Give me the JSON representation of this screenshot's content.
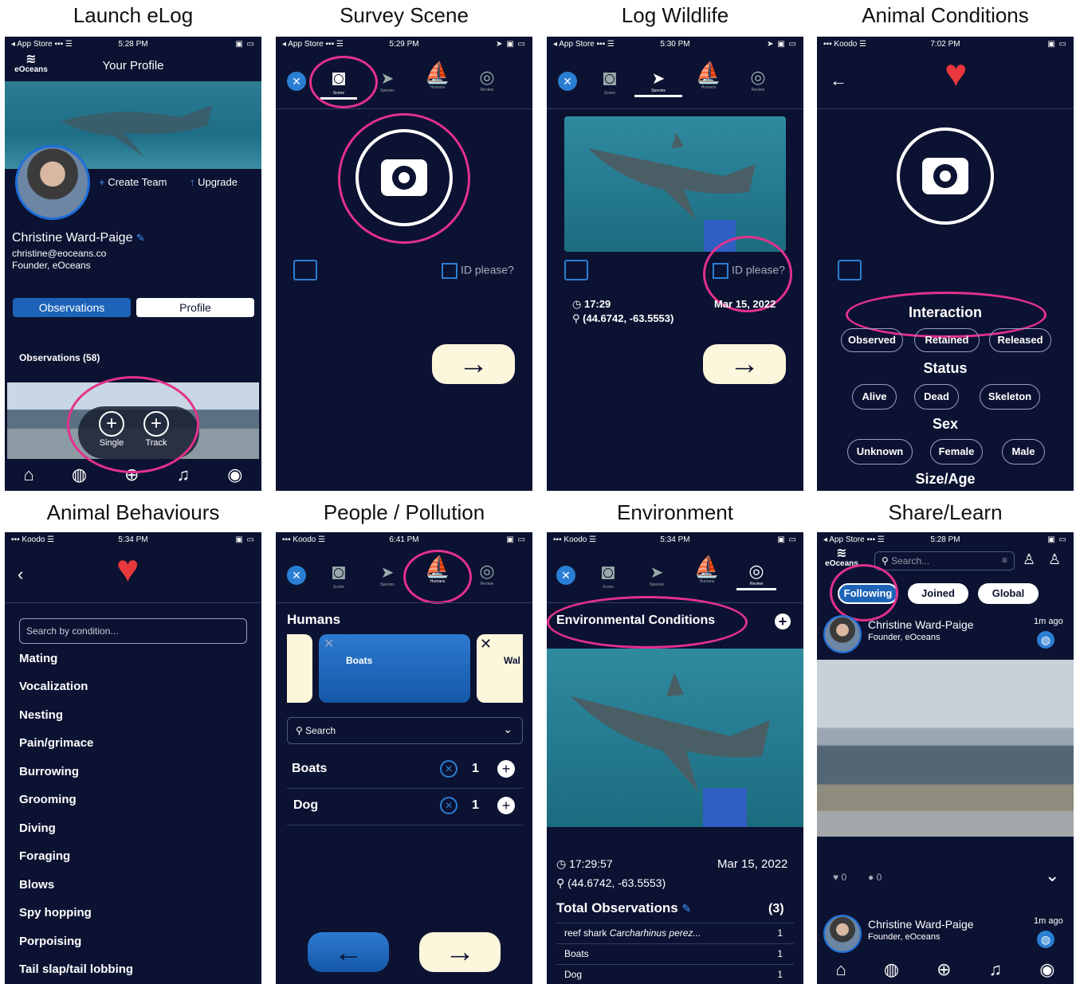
{
  "titles": [
    "Launch eLog",
    "Survey Scene",
    "Log Wildlife",
    "Animal Conditions",
    "Animal Behaviours",
    "People / Pollution",
    "Environment",
    "Share/Learn"
  ],
  "status": {
    "p1": {
      "left": "◂ App Store ▪▪▪ ☰",
      "time": "5:28 PM"
    },
    "p2": {
      "left": "◂ App Store ▪▪▪ ☰",
      "time": "5:29 PM"
    },
    "p3": {
      "left": "◂ App Store ▪▪▪ ☰",
      "time": "5:30 PM"
    },
    "p4": {
      "left": "▪▪▪ Koodo ☰",
      "time": "7:02 PM"
    },
    "p5": {
      "left": "▪▪▪ Koodo ☰",
      "time": "5:34 PM"
    },
    "p6": {
      "left": "▪▪▪ Koodo ☰",
      "time": "6:41 PM"
    },
    "p7": {
      "left": "▪▪▪ Koodo ☰",
      "time": "5:34 PM"
    },
    "p8": {
      "left": "◂ App Store ▪▪▪ ☰",
      "time": "5:28 PM"
    }
  },
  "profile": {
    "logo": "eOceans",
    "header": "Your Profile",
    "create_team": "Create Team",
    "upgrade": "Upgrade",
    "name": "Christine Ward-Paige",
    "email": "christine@eoceans.co",
    "role": "Founder, eOceans",
    "tab_observations": "Observations",
    "tab_profile": "Profile",
    "observations_count": "Observations (58)",
    "single": "Single",
    "track": "Track"
  },
  "tabs": {
    "scene": "Scene",
    "species": "Species",
    "humans": "Humans",
    "review": "Review"
  },
  "survey": {
    "id_please": "ID please?"
  },
  "wildlife": {
    "id_please": "ID please?",
    "time": "17:29",
    "coords": "(44.6742,  -63.5553)",
    "date": "Mar 15, 2022"
  },
  "conditions": {
    "interaction": "Interaction",
    "interaction_opts": [
      "Observed",
      "Retained",
      "Released"
    ],
    "status": "Status",
    "status_opts": [
      "Alive",
      "Dead",
      "Skeleton"
    ],
    "sex": "Sex",
    "sex_opts": [
      "Unknown",
      "Female",
      "Male"
    ],
    "size_age": "Size/Age"
  },
  "behaviours": {
    "search_placeholder": "Search by condition...",
    "items": [
      "Mating",
      "Vocalization",
      "Nesting",
      "Pain/grimace",
      "Burrowing",
      "Grooming",
      "Diving",
      "Foraging",
      "Blows",
      "Spy hopping",
      "Porpoising",
      "Tail slap/tail lobbing"
    ]
  },
  "people": {
    "header": "Humans",
    "card_main": "Boats",
    "card_right": "Wal",
    "search": "Search",
    "rows": [
      {
        "label": "Boats",
        "count": "1"
      },
      {
        "label": "Dog",
        "count": "1"
      }
    ]
  },
  "environment": {
    "header": "Environmental Conditions",
    "time": "17:29:57",
    "date": "Mar 15, 2022",
    "coords": "(44.6742, -63.5553)",
    "total_label": "Total Observations",
    "total_count": "(3)",
    "rows": [
      {
        "label": "reef shark",
        "sci": "Carcharhinus perez...",
        "count": "1"
      },
      {
        "label": "Boats",
        "sci": "",
        "count": "1"
      },
      {
        "label": "Dog",
        "sci": "",
        "count": "1"
      }
    ]
  },
  "share": {
    "search_placeholder": "Search...",
    "tab_following": "Following",
    "tab_joined": "Joined",
    "tab_global": "Global",
    "post_name": "Christine Ward-Paige",
    "post_name_cut": "Christine Ward-Paige",
    "post_role": "Founder, eOceans",
    "post_time": "1m ago",
    "likes": "0",
    "comments": "0",
    "post2_name": "Christine Ward-Paige",
    "post2_role": "Founder, eOceans",
    "post2_time": "1m ago"
  },
  "colors": {
    "bg": "#0c1231",
    "accent": "#e3318c",
    "blue": "#1d63b8",
    "cream": "#fcf6dd",
    "heart": "#e8383d"
  }
}
